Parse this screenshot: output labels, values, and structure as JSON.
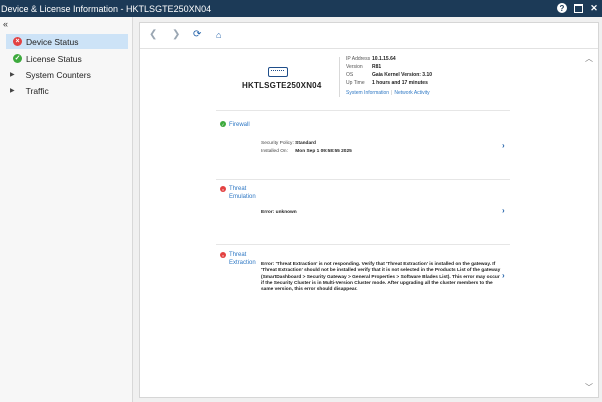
{
  "window": {
    "title": "Device & License Information - HKTLSGTE250XN04"
  },
  "sidebar": {
    "collapse_label": "«",
    "items": [
      {
        "label": "Device Status",
        "status": "error"
      },
      {
        "label": "License Status",
        "status": "ok"
      },
      {
        "label": "System Counters",
        "status": "collapsed"
      },
      {
        "label": "Traffic",
        "status": "collapsed"
      }
    ]
  },
  "toolbar": {
    "icons": [
      "back-icon",
      "forward-icon",
      "refresh-icon",
      "home-icon"
    ]
  },
  "device": {
    "name": "HKTLSGTE250XN04",
    "info": [
      {
        "label": "IP Address",
        "value": "10.1.15.64"
      },
      {
        "label": "Version",
        "value": "R81"
      },
      {
        "label": "OS",
        "value": "Gaia Kernel Version: 3.10"
      },
      {
        "label": "Up Time",
        "value": "1 hours and 17 minutes"
      }
    ],
    "links": [
      "System Information",
      "Network Activity"
    ]
  },
  "blades": [
    {
      "name": "Firewall",
      "status": "ok",
      "details": [
        {
          "label": "Security Policy:",
          "value": "Standard"
        },
        {
          "label": "Installed On:",
          "value": "Mon Sep 1 09:58:55 2025"
        }
      ]
    },
    {
      "name": "Threat Emulation",
      "status": "error",
      "error": "Error: unknown"
    },
    {
      "name": "Threat Extraction",
      "status": "error",
      "error": "Error: 'Threat Extraction' is not responding. Verify that 'Threat Extraction' is installed on the gateway. If 'Threat Extraction' should not be installed verify that it is not selected in the Products List of the gateway (SmartDashboard > Security Gateway > General Properties > Software Blades List). This error may occur if the Security Cluster is in Multi-Version Cluster mode. After upgrading all the cluster members to the same version, this error should disappear."
    }
  ],
  "colors": {
    "titlebar": "#1c3a57",
    "selected": "#cde3f7",
    "link": "#2f78c4",
    "error": "#e34242",
    "ok": "#3daa3d"
  }
}
